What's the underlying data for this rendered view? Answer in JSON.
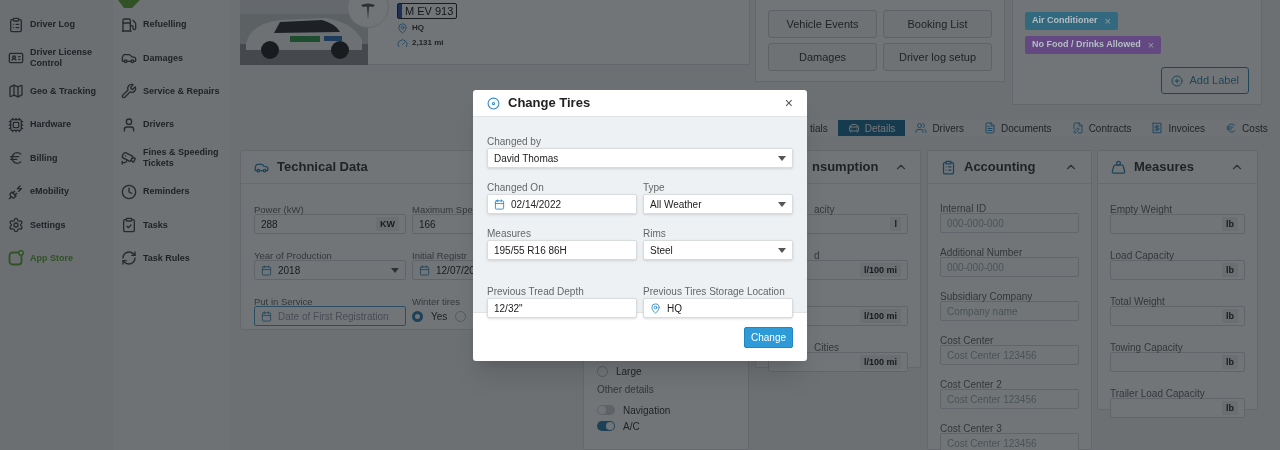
{
  "sidebar": {
    "primary": [
      {
        "label": "Driver Log",
        "kind": "normal"
      },
      {
        "label": "Driver License Control",
        "kind": "normal"
      },
      {
        "label": "Geo & Tracking",
        "kind": "normal"
      },
      {
        "label": "Hardware",
        "kind": "normal"
      },
      {
        "label": "Billing",
        "kind": "normal"
      },
      {
        "label": "eMobility",
        "kind": "normal"
      },
      {
        "label": "Settings",
        "kind": "normal"
      },
      {
        "label": "App Store",
        "kind": "featured"
      }
    ],
    "secondary": [
      {
        "label": "Refuelling"
      },
      {
        "label": "Damages"
      },
      {
        "label": "Service & Repairs"
      },
      {
        "label": "Drivers"
      },
      {
        "label": "Fines & Speeding Tickets"
      },
      {
        "label": "Reminders"
      },
      {
        "label": "Tasks"
      },
      {
        "label": "Task Rules"
      }
    ]
  },
  "vehicle": {
    "plate": "M EV 913",
    "location": "HQ",
    "mileage": "2,131 mi"
  },
  "quick_buttons": [
    "Vehicle Events",
    "Booking List",
    "Damages",
    "Driver log setup"
  ],
  "labels": {
    "tags": [
      {
        "text": "Air Conditioner",
        "color": "#33697e",
        "remove": "×"
      },
      {
        "text": "No Food / Drinks Allowed",
        "color": "#634882",
        "remove": "×"
      }
    ],
    "add_button": "Add Label"
  },
  "tabs": [
    {
      "label": "tials",
      "selected": false
    },
    {
      "label": "Details",
      "selected": true
    },
    {
      "label": "Drivers",
      "selected": false
    },
    {
      "label": "Documents",
      "selected": false
    },
    {
      "label": "Contracts",
      "selected": false
    },
    {
      "label": "Invoices",
      "selected": false
    },
    {
      "label": "Costs",
      "selected": false
    }
  ],
  "technical_data": {
    "title": "Technical Data",
    "fields": [
      {
        "kind": "text",
        "label": "Power (kW)",
        "value": "288",
        "unit": "KW",
        "focused": false
      },
      {
        "kind": "text",
        "label": "Maximum Spe",
        "value": "166",
        "focused": false
      },
      {
        "kind": "year",
        "label": "Year of Production",
        "value": "2018",
        "focused": false
      },
      {
        "kind": "date",
        "label": "Initial Registr",
        "value": "12/07/20",
        "focused": false
      },
      {
        "kind": "date",
        "label": "Put in Service",
        "placeholder": "Date of First Registration",
        "focused": true
      },
      {
        "kind": "radio",
        "label": "Winter tires",
        "options": [
          {
            "label": "Yes",
            "selected": true
          },
          {
            "selected": false
          }
        ]
      }
    ]
  },
  "other_card": {
    "options": [
      {
        "label": "Large",
        "selected": false
      }
    ],
    "heading": "Other details",
    "toggles": [
      {
        "label": "Navigation",
        "on": false
      },
      {
        "label": "A/C",
        "on": true
      }
    ]
  },
  "consumption": {
    "title": "nsumption",
    "fields": [
      {
        "label": "acity",
        "unit": "l"
      },
      {
        "label": "d",
        "unit": "l/100 mi"
      },
      {
        "unit": "l/100 mi"
      },
      {
        "label": "Cities",
        "unit": "l/100 mi"
      }
    ]
  },
  "accounting": {
    "title": "Accounting",
    "fields": [
      {
        "label": "Internal ID",
        "placeholder": "000-000-000"
      },
      {
        "label": "Additional Number",
        "placeholder": "000-000-000"
      },
      {
        "label": "Subsidiary Company",
        "placeholder": "Company name"
      },
      {
        "label": "Cost Center",
        "placeholder": "Cost Center 123456"
      },
      {
        "label": "Cost Center 2",
        "placeholder": "Cost Center 123456"
      },
      {
        "label": "Cost Center 3",
        "placeholder": "Cost Center 123456"
      }
    ]
  },
  "measures": {
    "title": "Measures",
    "fields": [
      {
        "label": "Empty Weight",
        "unit": "lb"
      },
      {
        "label": "Load Capacity",
        "unit": "lb"
      },
      {
        "label": "Total Weight",
        "unit": "lb"
      },
      {
        "label": "Towing Capacity",
        "unit": "lb"
      },
      {
        "label": "Trailer Load Capacity",
        "unit": "lb"
      }
    ]
  },
  "dialog": {
    "title": "Change Tires",
    "close": "×",
    "rows": [
      [
        {
          "kind": "select",
          "label": "Changed by",
          "value": "David Thomas"
        }
      ],
      [
        {
          "kind": "date",
          "label": "Changed On",
          "value": "02/14/2022"
        },
        {
          "kind": "select",
          "label": "Type",
          "value": "All Weather"
        }
      ],
      [
        {
          "kind": "text",
          "label": "Measures",
          "value": "195/55 R16 86H"
        },
        {
          "kind": "select",
          "label": "Rims",
          "value": "Steel"
        }
      ],
      [
        {
          "kind": "text",
          "label": "Previous Tread Depth",
          "value": "12/32\""
        },
        {
          "kind": "location",
          "label": "Previous Tires Storage Location",
          "value": "HQ"
        }
      ]
    ],
    "submit": "Change"
  }
}
